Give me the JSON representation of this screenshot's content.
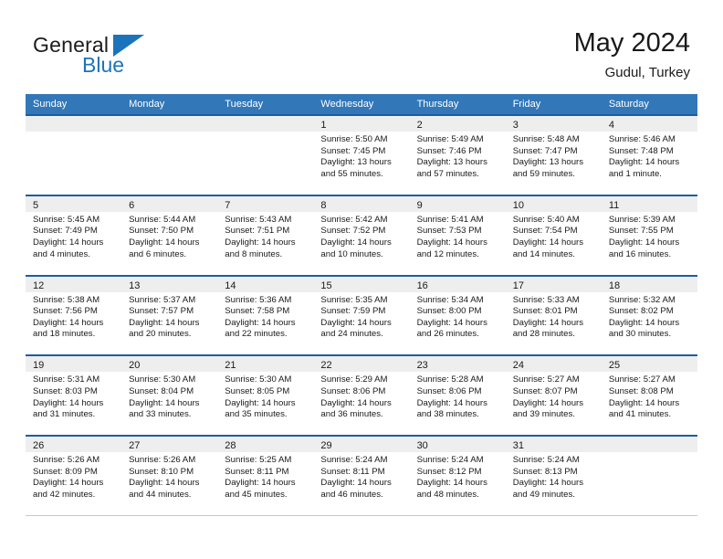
{
  "brand": {
    "name_top": "General",
    "name_bottom": "Blue",
    "accent_color": "#1b74bb",
    "triangle_icon": "brand-triangle-icon"
  },
  "header": {
    "title": "May 2024",
    "subtitle": "Gudul, Turkey"
  },
  "theme": {
    "header_bg": "#3277b8",
    "cell_top_border": "#1b5e9e",
    "daynum_band_bg": "#eeeeee"
  },
  "weekdays": [
    "Sunday",
    "Monday",
    "Tuesday",
    "Wednesday",
    "Thursday",
    "Friday",
    "Saturday"
  ],
  "weeks": [
    [
      {
        "day": "",
        "sunrise": "",
        "sunset": "",
        "daylight_1": "",
        "daylight_2": ""
      },
      {
        "day": "",
        "sunrise": "",
        "sunset": "",
        "daylight_1": "",
        "daylight_2": ""
      },
      {
        "day": "",
        "sunrise": "",
        "sunset": "",
        "daylight_1": "",
        "daylight_2": ""
      },
      {
        "day": "1",
        "sunrise": "Sunrise: 5:50 AM",
        "sunset": "Sunset: 7:45 PM",
        "daylight_1": "Daylight: 13 hours",
        "daylight_2": "and 55 minutes."
      },
      {
        "day": "2",
        "sunrise": "Sunrise: 5:49 AM",
        "sunset": "Sunset: 7:46 PM",
        "daylight_1": "Daylight: 13 hours",
        "daylight_2": "and 57 minutes."
      },
      {
        "day": "3",
        "sunrise": "Sunrise: 5:48 AM",
        "sunset": "Sunset: 7:47 PM",
        "daylight_1": "Daylight: 13 hours",
        "daylight_2": "and 59 minutes."
      },
      {
        "day": "4",
        "sunrise": "Sunrise: 5:46 AM",
        "sunset": "Sunset: 7:48 PM",
        "daylight_1": "Daylight: 14 hours",
        "daylight_2": "and 1 minute."
      }
    ],
    [
      {
        "day": "5",
        "sunrise": "Sunrise: 5:45 AM",
        "sunset": "Sunset: 7:49 PM",
        "daylight_1": "Daylight: 14 hours",
        "daylight_2": "and 4 minutes."
      },
      {
        "day": "6",
        "sunrise": "Sunrise: 5:44 AM",
        "sunset": "Sunset: 7:50 PM",
        "daylight_1": "Daylight: 14 hours",
        "daylight_2": "and 6 minutes."
      },
      {
        "day": "7",
        "sunrise": "Sunrise: 5:43 AM",
        "sunset": "Sunset: 7:51 PM",
        "daylight_1": "Daylight: 14 hours",
        "daylight_2": "and 8 minutes."
      },
      {
        "day": "8",
        "sunrise": "Sunrise: 5:42 AM",
        "sunset": "Sunset: 7:52 PM",
        "daylight_1": "Daylight: 14 hours",
        "daylight_2": "and 10 minutes."
      },
      {
        "day": "9",
        "sunrise": "Sunrise: 5:41 AM",
        "sunset": "Sunset: 7:53 PM",
        "daylight_1": "Daylight: 14 hours",
        "daylight_2": "and 12 minutes."
      },
      {
        "day": "10",
        "sunrise": "Sunrise: 5:40 AM",
        "sunset": "Sunset: 7:54 PM",
        "daylight_1": "Daylight: 14 hours",
        "daylight_2": "and 14 minutes."
      },
      {
        "day": "11",
        "sunrise": "Sunrise: 5:39 AM",
        "sunset": "Sunset: 7:55 PM",
        "daylight_1": "Daylight: 14 hours",
        "daylight_2": "and 16 minutes."
      }
    ],
    [
      {
        "day": "12",
        "sunrise": "Sunrise: 5:38 AM",
        "sunset": "Sunset: 7:56 PM",
        "daylight_1": "Daylight: 14 hours",
        "daylight_2": "and 18 minutes."
      },
      {
        "day": "13",
        "sunrise": "Sunrise: 5:37 AM",
        "sunset": "Sunset: 7:57 PM",
        "daylight_1": "Daylight: 14 hours",
        "daylight_2": "and 20 minutes."
      },
      {
        "day": "14",
        "sunrise": "Sunrise: 5:36 AM",
        "sunset": "Sunset: 7:58 PM",
        "daylight_1": "Daylight: 14 hours",
        "daylight_2": "and 22 minutes."
      },
      {
        "day": "15",
        "sunrise": "Sunrise: 5:35 AM",
        "sunset": "Sunset: 7:59 PM",
        "daylight_1": "Daylight: 14 hours",
        "daylight_2": "and 24 minutes."
      },
      {
        "day": "16",
        "sunrise": "Sunrise: 5:34 AM",
        "sunset": "Sunset: 8:00 PM",
        "daylight_1": "Daylight: 14 hours",
        "daylight_2": "and 26 minutes."
      },
      {
        "day": "17",
        "sunrise": "Sunrise: 5:33 AM",
        "sunset": "Sunset: 8:01 PM",
        "daylight_1": "Daylight: 14 hours",
        "daylight_2": "and 28 minutes."
      },
      {
        "day": "18",
        "sunrise": "Sunrise: 5:32 AM",
        "sunset": "Sunset: 8:02 PM",
        "daylight_1": "Daylight: 14 hours",
        "daylight_2": "and 30 minutes."
      }
    ],
    [
      {
        "day": "19",
        "sunrise": "Sunrise: 5:31 AM",
        "sunset": "Sunset: 8:03 PM",
        "daylight_1": "Daylight: 14 hours",
        "daylight_2": "and 31 minutes."
      },
      {
        "day": "20",
        "sunrise": "Sunrise: 5:30 AM",
        "sunset": "Sunset: 8:04 PM",
        "daylight_1": "Daylight: 14 hours",
        "daylight_2": "and 33 minutes."
      },
      {
        "day": "21",
        "sunrise": "Sunrise: 5:30 AM",
        "sunset": "Sunset: 8:05 PM",
        "daylight_1": "Daylight: 14 hours",
        "daylight_2": "and 35 minutes."
      },
      {
        "day": "22",
        "sunrise": "Sunrise: 5:29 AM",
        "sunset": "Sunset: 8:06 PM",
        "daylight_1": "Daylight: 14 hours",
        "daylight_2": "and 36 minutes."
      },
      {
        "day": "23",
        "sunrise": "Sunrise: 5:28 AM",
        "sunset": "Sunset: 8:06 PM",
        "daylight_1": "Daylight: 14 hours",
        "daylight_2": "and 38 minutes."
      },
      {
        "day": "24",
        "sunrise": "Sunrise: 5:27 AM",
        "sunset": "Sunset: 8:07 PM",
        "daylight_1": "Daylight: 14 hours",
        "daylight_2": "and 39 minutes."
      },
      {
        "day": "25",
        "sunrise": "Sunrise: 5:27 AM",
        "sunset": "Sunset: 8:08 PM",
        "daylight_1": "Daylight: 14 hours",
        "daylight_2": "and 41 minutes."
      }
    ],
    [
      {
        "day": "26",
        "sunrise": "Sunrise: 5:26 AM",
        "sunset": "Sunset: 8:09 PM",
        "daylight_1": "Daylight: 14 hours",
        "daylight_2": "and 42 minutes."
      },
      {
        "day": "27",
        "sunrise": "Sunrise: 5:26 AM",
        "sunset": "Sunset: 8:10 PM",
        "daylight_1": "Daylight: 14 hours",
        "daylight_2": "and 44 minutes."
      },
      {
        "day": "28",
        "sunrise": "Sunrise: 5:25 AM",
        "sunset": "Sunset: 8:11 PM",
        "daylight_1": "Daylight: 14 hours",
        "daylight_2": "and 45 minutes."
      },
      {
        "day": "29",
        "sunrise": "Sunrise: 5:24 AM",
        "sunset": "Sunset: 8:11 PM",
        "daylight_1": "Daylight: 14 hours",
        "daylight_2": "and 46 minutes."
      },
      {
        "day": "30",
        "sunrise": "Sunrise: 5:24 AM",
        "sunset": "Sunset: 8:12 PM",
        "daylight_1": "Daylight: 14 hours",
        "daylight_2": "and 48 minutes."
      },
      {
        "day": "31",
        "sunrise": "Sunrise: 5:24 AM",
        "sunset": "Sunset: 8:13 PM",
        "daylight_1": "Daylight: 14 hours",
        "daylight_2": "and 49 minutes."
      },
      {
        "day": "",
        "sunrise": "",
        "sunset": "",
        "daylight_1": "",
        "daylight_2": ""
      }
    ]
  ]
}
